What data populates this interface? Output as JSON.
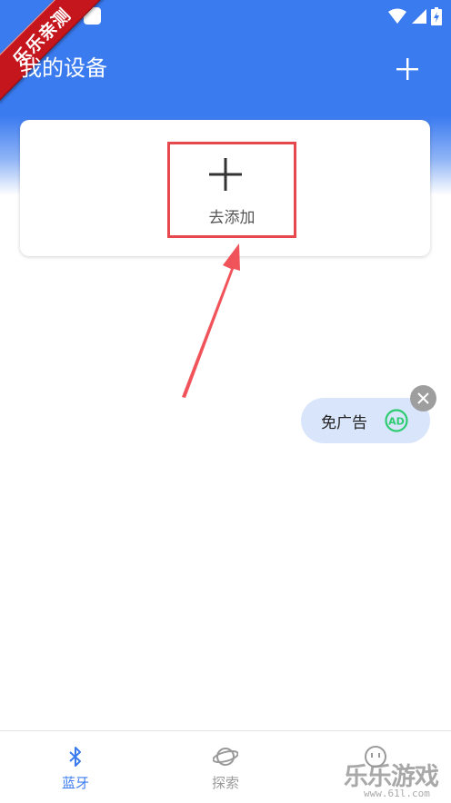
{
  "header": {
    "title": "我的设备",
    "add_icon": "plus-icon"
  },
  "status_bar": {
    "icons": [
      "wifi-icon",
      "signal-icon",
      "battery-icon"
    ]
  },
  "ribbon": {
    "text": "乐乐亲测"
  },
  "device_card": {
    "add_label": "去添加",
    "add_icon": "plus-icon"
  },
  "ad_pill": {
    "label": "免广告",
    "badge_icon": "ad-icon",
    "close_icon": "close-icon"
  },
  "bottom_nav": {
    "items": [
      {
        "label": "蓝牙",
        "icon": "bluetooth-icon",
        "active": true
      },
      {
        "label": "探索",
        "icon": "planet-icon",
        "active": false
      },
      {
        "label": "",
        "icon": "profile-icon",
        "active": false
      }
    ]
  },
  "watermark": {
    "main": "乐乐游戏",
    "sub": "www.61l.com"
  },
  "colors": {
    "primary": "#3b7bf0",
    "highlight_box": "#e6484d",
    "ad_pill_bg": "#d9e5fb",
    "ad_green": "#2ecc71"
  }
}
